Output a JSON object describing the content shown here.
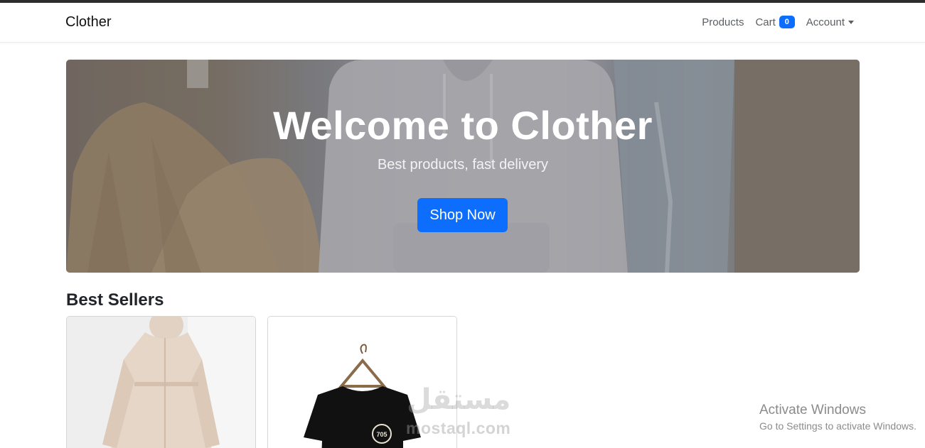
{
  "navbar": {
    "brand": "Clother",
    "links": {
      "products": "Products",
      "cart": "Cart",
      "cart_count": "0",
      "account": "Account"
    }
  },
  "hero": {
    "title": "Welcome to Clother",
    "subtitle": "Best products, fast delivery",
    "button_label": "Shop Now"
  },
  "best_sellers": {
    "title": "Best Sellers",
    "products": [
      {
        "image": "beige-abaya-dress"
      },
      {
        "image": "black-tshirt-on-hanger",
        "print_text": "705"
      }
    ]
  },
  "watermark": {
    "arabic": "مستقل",
    "latin": "mostaql.com"
  },
  "os_notice": {
    "title": "Activate Windows",
    "subtitle": "Go to Settings to activate Windows."
  },
  "colors": {
    "primary": "#0d6efd",
    "text": "#212529",
    "nav_link": "#5a5f64"
  }
}
